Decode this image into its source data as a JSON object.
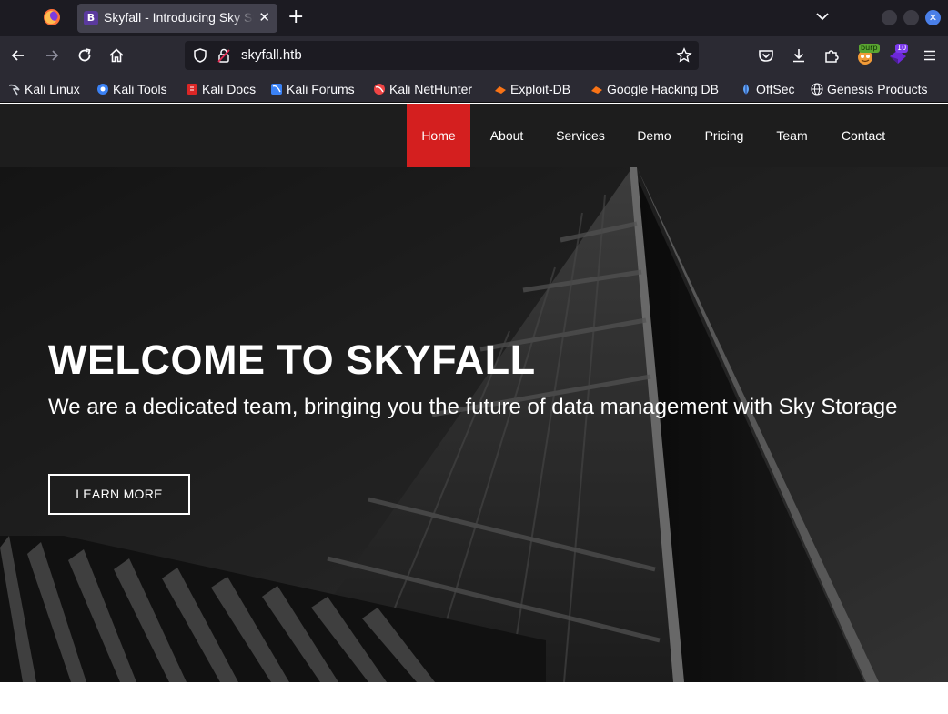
{
  "browser": {
    "tab": {
      "favicon_letter": "B",
      "title": "Skyfall - Introducing Sky Storage"
    },
    "url": "skyfall.htb",
    "extensions": {
      "burp_badge": "burp",
      "counter_badge": "10"
    },
    "bookmarks": [
      {
        "label": "Kali Linux",
        "icon": "kali-linux-icon",
        "color": "#cfd3da"
      },
      {
        "label": "Kali Tools",
        "icon": "kali-tools-icon",
        "color": "#3b82f6"
      },
      {
        "label": "Kali Docs",
        "icon": "kali-docs-icon",
        "color": "#dc2626"
      },
      {
        "label": "Kali Forums",
        "icon": "kali-forums-icon",
        "color": "#3b82f6"
      },
      {
        "label": "Kali NetHunter",
        "icon": "kali-nethunter-icon",
        "color": "#ef4444"
      },
      {
        "label": "Exploit-DB",
        "icon": "exploit-db-icon",
        "color": "#f97316"
      },
      {
        "label": "Google Hacking DB",
        "icon": "google-hacking-db-icon",
        "color": "#f97316"
      },
      {
        "label": "OffSec",
        "icon": "offsec-icon",
        "color": "#60a5fa"
      },
      {
        "label": "Genesis Products",
        "icon": "globe-icon",
        "color": "#fbfbfe"
      }
    ]
  },
  "site": {
    "menu": [
      {
        "label": "Home",
        "active": true
      },
      {
        "label": "About",
        "active": false
      },
      {
        "label": "Services",
        "active": false
      },
      {
        "label": "Demo",
        "active": false
      },
      {
        "label": "Pricing",
        "active": false
      },
      {
        "label": "Team",
        "active": false
      },
      {
        "label": "Contact",
        "active": false
      }
    ],
    "accent_color": "#d41f1f",
    "hero": {
      "title": "WELCOME TO SKYFALL",
      "subtitle": "We are a dedicated team, bringing you the future of data management with Sky Storage",
      "button": "LEARN MORE"
    }
  }
}
